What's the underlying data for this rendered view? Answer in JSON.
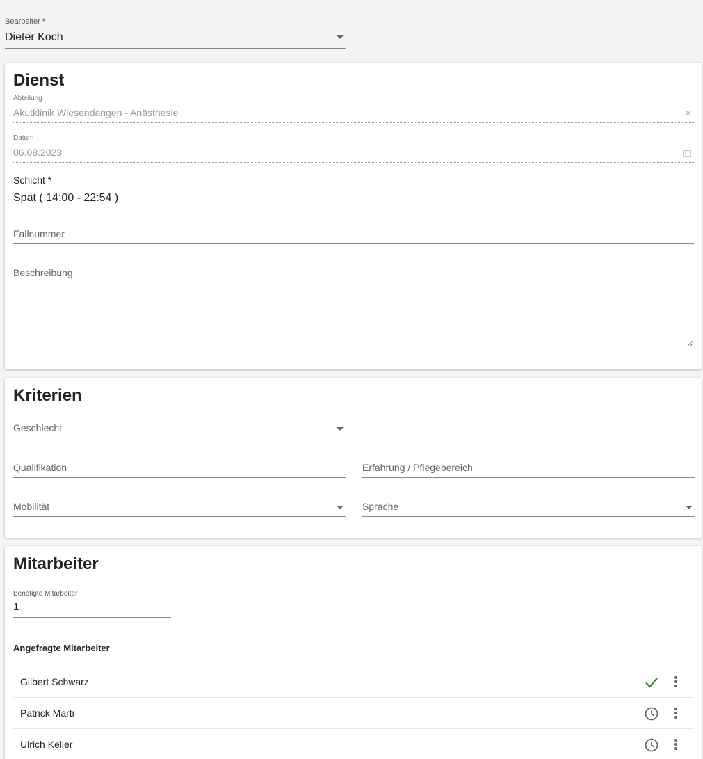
{
  "bearbeiter": {
    "label": "Bearbeiter *",
    "value": "Dieter Koch"
  },
  "dienst": {
    "title": "Dienst",
    "abteilung": {
      "label": "Abteilung",
      "value": "Akutklinik Wiesendangen - Anästhesie"
    },
    "datum": {
      "label": "Datum",
      "value": "06.08.2023"
    },
    "schicht": {
      "label": "Schicht *",
      "value": "Spät ( 14:00 - 22:54 )"
    },
    "fallnummer": {
      "label": "Fallnummer"
    },
    "beschreibung": {
      "label": "Beschreibung"
    }
  },
  "kriterien": {
    "title": "Kriterien",
    "geschlecht": "Geschlecht",
    "qualifikation": "Qualifikation",
    "erfahrung": "Erfahrung / Pflegebereich",
    "mobilitaet": "Mobilität",
    "sprache": "Sprache"
  },
  "mitarbeiter": {
    "title": "Mitarbeiter",
    "benoetigte": {
      "label": "Benötigte Mitarbeiter",
      "value": "1"
    },
    "angefragte_title": "Angefragte Mitarbeiter",
    "rows": [
      {
        "name": "Gilbert Schwarz",
        "status": "check-icon"
      },
      {
        "name": "Patrick Marti",
        "status": "clock-icon"
      },
      {
        "name": "Ulrich Keller",
        "status": "clock-icon"
      }
    ]
  },
  "colors": {
    "check": "#2e8b2e",
    "icon_gray": "#666666"
  }
}
